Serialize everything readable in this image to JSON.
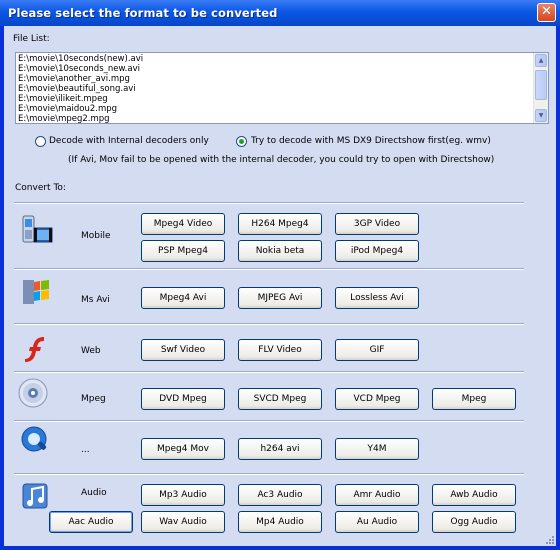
{
  "window": {
    "title": "Please select the format to be converted",
    "close_symbol": "✕"
  },
  "file_list": {
    "label": "File List:",
    "files": [
      "E:\\movie\\10seconds(new).avi",
      "E:\\movie\\10seconds_new.avi",
      "E:\\movie\\another_avi.mpg",
      "E:\\movie\\beautiful_song.avi",
      "E:\\movie\\ilikeit.mpeg",
      "E:\\movie\\maidou2.mpg",
      "E:\\movie\\mpeg2.mpg"
    ],
    "scroll_up": "▲",
    "scroll_down": "▼"
  },
  "decode_options": {
    "internal_label": "Decode with Internal decoders only",
    "directshow_label": "Try to decode with MS DX9 Directshow first(eg. wmv)",
    "selected": "directshow",
    "hint": "(If Avi, Mov fail to be opened with the internal decoder, you could try to open with Directshow)"
  },
  "convert_to_label": "Convert To:",
  "groups": [
    {
      "id": "mobile",
      "name": "Mobile",
      "icon": "mobile-phone-icon",
      "buttons": [
        "Mpeg4 Video",
        "H264 Mpeg4",
        "3GP Video",
        "PSP Mpeg4",
        "Nokia beta",
        "iPod Mpeg4"
      ]
    },
    {
      "id": "msavi",
      "name": "Ms Avi",
      "icon": "windows-logo-icon",
      "buttons": [
        "Mpeg4 Avi",
        "MJPEG Avi",
        "Lossless Avi"
      ]
    },
    {
      "id": "web",
      "name": "Web",
      "icon": "flash-icon",
      "buttons": [
        "Swf Video",
        "FLV Video",
        "GIF"
      ]
    },
    {
      "id": "mpeg",
      "name": "Mpeg",
      "icon": "disc-icon",
      "buttons": [
        "DVD Mpeg",
        "SVCD Mpeg",
        "VCD Mpeg",
        "Mpeg"
      ]
    },
    {
      "id": "other",
      "name": "...",
      "icon": "quicktime-icon",
      "buttons": [
        "Mpeg4 Mov",
        "h264 avi",
        "Y4M"
      ]
    },
    {
      "id": "audio",
      "name": "Audio",
      "icon": "music-note-icon",
      "buttons": [
        "Mp3 Audio",
        "Ac3 Audio",
        "Amr Audio",
        "Awb Audio",
        "Aac Audio",
        "Wav Audio",
        "Mp4 Audio",
        "Au Audio",
        "Ogg Audio"
      ]
    }
  ]
}
